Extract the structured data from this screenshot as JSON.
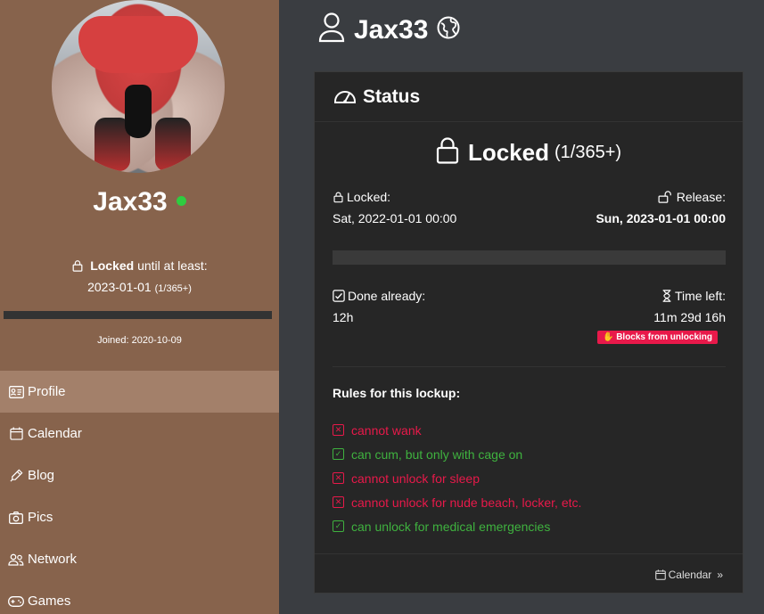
{
  "profile": {
    "username": "Jax33",
    "status_prefix": "Locked",
    "status_suffix": "until at least:",
    "until_date": "2023-01-01",
    "until_count": "(1/365+)",
    "joined": "Joined: 2020-10-09",
    "online_color": "#2ecc40"
  },
  "nav": {
    "items": [
      {
        "label": "Profile",
        "icon": "id-card-icon",
        "active": true
      },
      {
        "label": "Calendar",
        "icon": "calendar-icon"
      },
      {
        "label": "Blog",
        "icon": "pen-icon"
      },
      {
        "label": "Pics",
        "icon": "camera-icon"
      },
      {
        "label": "Network",
        "icon": "people-icon"
      },
      {
        "label": "Games",
        "icon": "gamepad-icon"
      }
    ]
  },
  "header": {
    "title": "Jax33",
    "user_icon": "user-icon",
    "globe_icon": "globe-icon"
  },
  "status_panel": {
    "title": "Status",
    "state": "Locked",
    "state_count": "(1/365+)",
    "locked_label": "Locked:",
    "locked_date": "Sat, 2022-01-01 00:00",
    "release_label": "Release:",
    "release_date": "Sun, 2023-01-01 00:00",
    "done_label": "Done already:",
    "done_value": "12h",
    "left_label": "Time left:",
    "left_value": "11m 29d 16h",
    "badge": "Blocks from unlocking",
    "badge_color": "#e8194a",
    "rules_title": "Rules for this lockup:",
    "rules": [
      {
        "text": "cannot wank",
        "allowed": false
      },
      {
        "text": "can cum, but only with cage on",
        "allowed": true
      },
      {
        "text": "cannot unlock for sleep",
        "allowed": false
      },
      {
        "text": "cannot unlock for nude beach, locker, etc.",
        "allowed": false
      },
      {
        "text": "can unlock for medical emergencies",
        "allowed": true
      }
    ],
    "footer_link": "Calendar"
  }
}
